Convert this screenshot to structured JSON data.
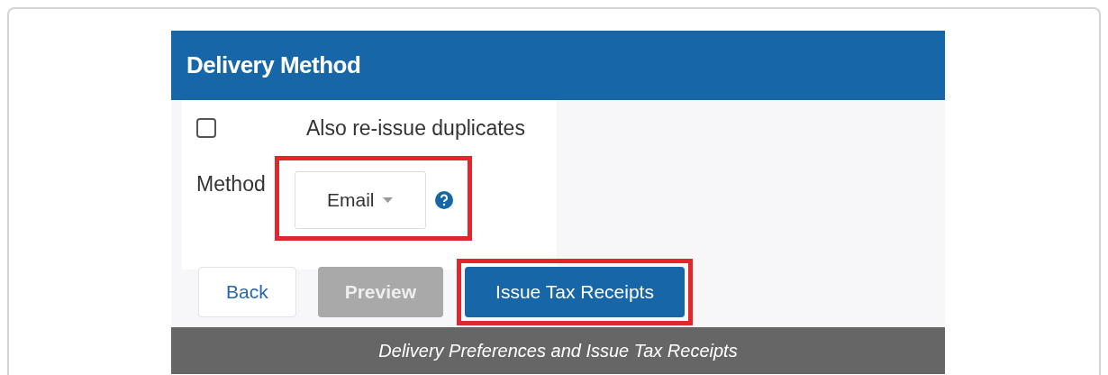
{
  "panel": {
    "title": "Delivery Method"
  },
  "duplicates": {
    "label": "Also re-issue duplicates",
    "checked": false
  },
  "method": {
    "label": "Method",
    "value": "Email",
    "highlighted": true
  },
  "buttons": [
    {
      "label": "Back",
      "kind": "secondary",
      "highlighted": false
    },
    {
      "label": "Preview",
      "kind": "disabled",
      "highlighted": false
    },
    {
      "label": "Issue Tax Receipts",
      "kind": "primary",
      "highlighted": true
    }
  ],
  "caption": "Delivery Preferences and Issue Tax Receipts"
}
